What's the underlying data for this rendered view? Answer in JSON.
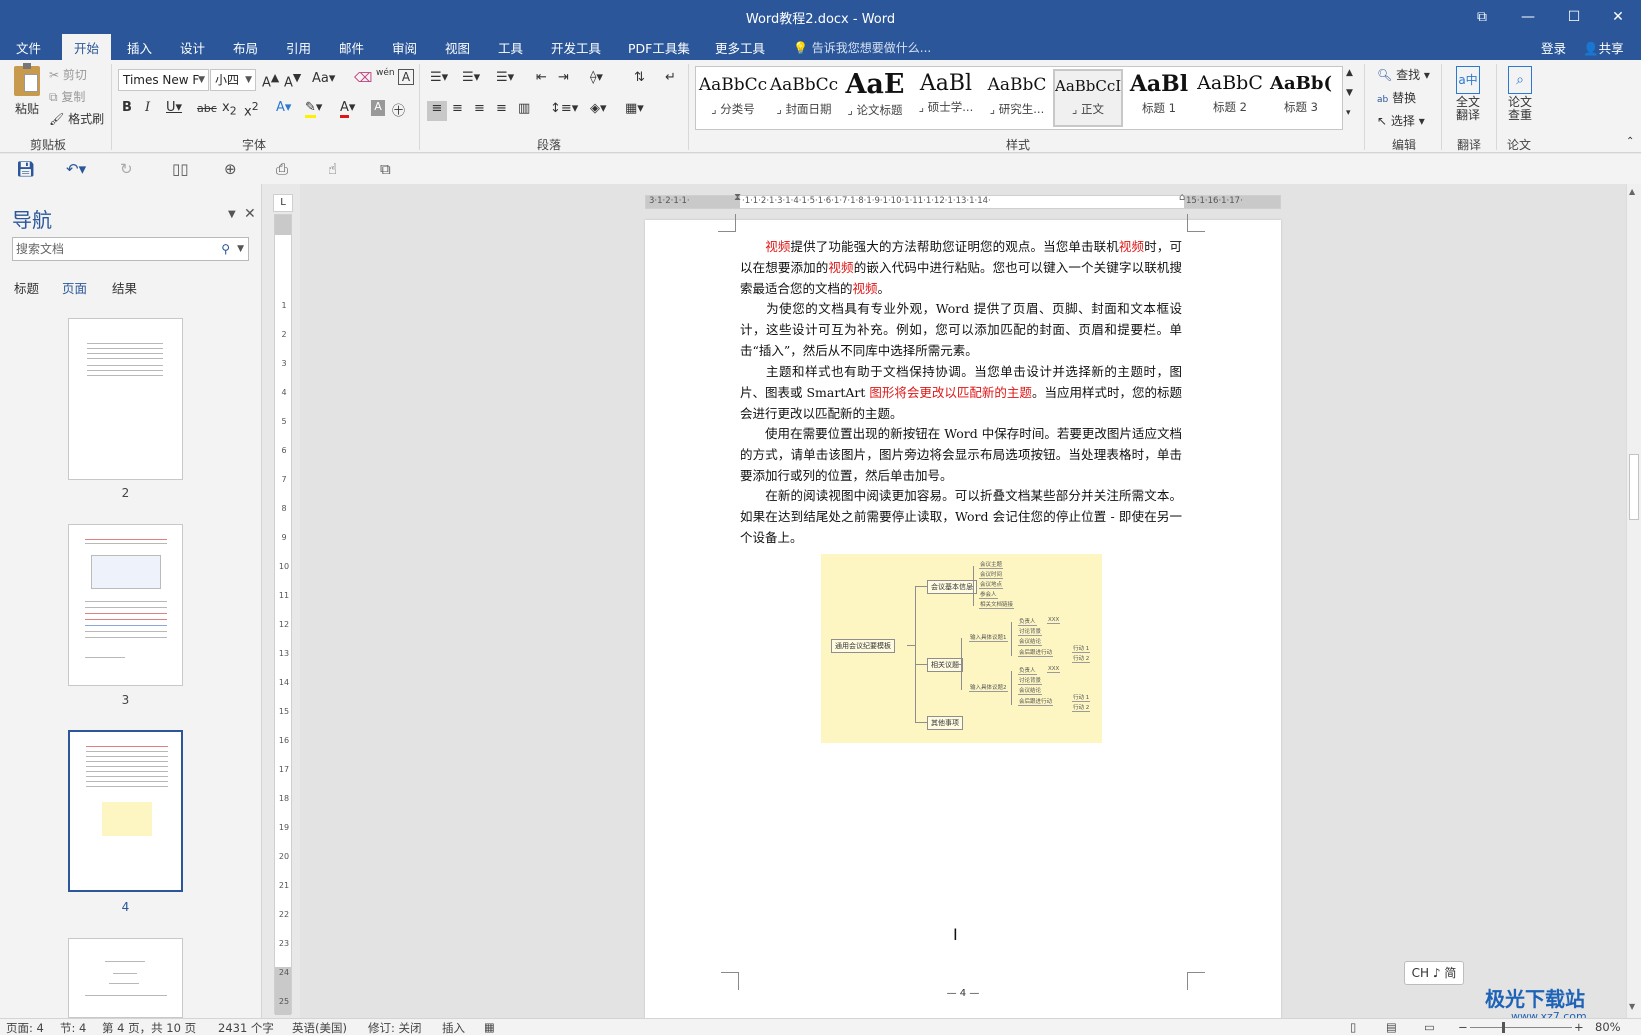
{
  "window": {
    "title": "Word教程2.docx - Word",
    "controls": {
      "restore": "⧉",
      "minimize": "—",
      "maximize": "☐",
      "close": "✕"
    }
  },
  "tabs": {
    "items": [
      "文件",
      "开始",
      "插入",
      "设计",
      "布局",
      "引用",
      "邮件",
      "审阅",
      "视图",
      "工具",
      "开发工具",
      "PDF工具集",
      "更多工具"
    ],
    "active": "开始",
    "tell_me": "告诉我您想要做什么...",
    "login": "登录",
    "share": "共享"
  },
  "ribbon": {
    "clipboard": {
      "paste": "粘贴",
      "cut": "剪切",
      "copy": "复制",
      "format_painter": "格式刷",
      "label": "剪贴板"
    },
    "font": {
      "name": "Times New F",
      "size": "小四",
      "case": "Aa",
      "label": "字体",
      "wen": "wén"
    },
    "paragraph": {
      "label": "段落"
    },
    "styles": {
      "label": "样式",
      "items": [
        {
          "sample": "AaBbCc",
          "name": "⌟ 分类号"
        },
        {
          "sample": "AaBbCc",
          "name": "⌟ 封面日期"
        },
        {
          "sample": "AaE",
          "name": "⌟ 论文标题"
        },
        {
          "sample": "AaBl",
          "name": "⌟ 硕士学..."
        },
        {
          "sample": "AaBbC",
          "name": "⌟ 研究生..."
        },
        {
          "sample": "AaBbCcI",
          "name": "⌟ 正文"
        },
        {
          "sample": "AaBl",
          "name": "标题 1"
        },
        {
          "sample": "AaBbC",
          "name": "标题 2"
        },
        {
          "sample": "AaBb(",
          "name": "标题 3"
        }
      ],
      "selected_index": 5
    },
    "editing": {
      "find": "查找",
      "replace": "替换",
      "select": "选择",
      "label": "编辑"
    },
    "translate": {
      "full": "全文\n翻译",
      "label": "翻译"
    },
    "paper": {
      "check": "论文\n查重",
      "label": "论文"
    }
  },
  "nav": {
    "title": "导航",
    "search_placeholder": "搜索文档",
    "tabs": [
      "标题",
      "页面",
      "结果"
    ],
    "active_tab": "页面",
    "pages": [
      "2",
      "3",
      "4"
    ],
    "active_page": "4"
  },
  "document": {
    "paragraphs": [
      [
        {
          "t": "　　"
        },
        {
          "t": "视频",
          "red": true
        },
        {
          "t": "提供了功能强大的方法帮助您证明您的观点。当您单击联机"
        },
        {
          "t": "视频",
          "red": true
        },
        {
          "t": "时，可以在想要添加的"
        },
        {
          "t": "视频",
          "red": true
        },
        {
          "t": "的嵌入代码中进行粘贴。您也可以键入一个关键字以联机搜索最适合您的文档的"
        },
        {
          "t": "视频",
          "red": true
        },
        {
          "t": "。"
        }
      ],
      [
        {
          "t": "　　为使您的文档具有专业外观，Word 提供了页眉、页脚、封面和文本框设计，这些设计可互为补充。例如，您可以添加匹配的封面、页眉和提要栏。单击“插入”，然后从不同库中选择所需元素。"
        }
      ],
      [
        {
          "t": "　　主题和样式也有助于文档保持协调。当您单击设计并选择新的主题时，图片、图表或 SmartArt "
        },
        {
          "t": "图形将会更改以匹配新的主题",
          "red": true
        },
        {
          "t": "。当应用样式时，您的标题会进行更改以匹配新的主题。"
        }
      ],
      [
        {
          "t": "　　使用在需要位置出现的新按钮在 Word 中保存时间。若要更改图片适应文档的方式，请单击该图片，图片旁边将会显示布局选项按钮。当处理表格时，单击要添加行或列的位置，然后单击加号。"
        }
      ],
      [
        {
          "t": "　　在新的阅读视图中阅读更加容易。可以折叠文档某些部分并关注所需文本。如果在达到结尾处之前需要停止读取，Word 会记住您的停止位置 - 即使在另一个设备上。"
        }
      ]
    ],
    "mindmap": {
      "root": "通用会议纪要模板",
      "branches": [
        {
          "label": "会议基本信息",
          "leaves": [
            "会议主题",
            "会议时间",
            "会议地点",
            "参会人",
            "相关文档链接"
          ]
        },
        {
          "label": "相关议题",
          "subs": [
            {
              "label": "输入具体议题1",
              "leaves": [
                "负责人",
                "讨论背景",
                "会议结论",
                "会后跟进行动"
              ],
              "extra": [
                "XXX",
                "行动 1",
                "行动 2"
              ]
            },
            {
              "label": "输入具体议题2",
              "leaves": [
                "负责人",
                "讨论背景",
                "会议结论",
                "会后跟进行动"
              ],
              "extra": [
                "XXX",
                "行动 1",
                "行动 2"
              ]
            }
          ]
        },
        {
          "label": "其他事项",
          "leaves": []
        }
      ]
    },
    "page_number": "— 4 —"
  },
  "ime": "CH ♪ 简",
  "status": {
    "page": "页面: 4",
    "section": "节: 4",
    "pages": "第 4 页，共 10 页",
    "words": "2431 个字",
    "language": "英语(美国)",
    "revisions": "修订: 关闭",
    "mode": "插入",
    "zoom": "80%"
  },
  "watermark": {
    "main": "极光下载站",
    "sub": "www.xz7.com"
  }
}
